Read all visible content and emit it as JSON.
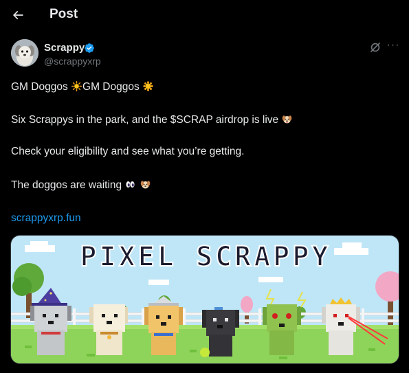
{
  "header": {
    "title": "Post"
  },
  "author": {
    "name": "Scrappy",
    "handle": "@scrappyxrp"
  },
  "post": {
    "line1_a": "GM Doggos",
    "line1_b": "GM Doggos",
    "line2": "Six Scrappys in the park, and the $SCRAP airdrop is live",
    "line3": "Check your eligibility and see what you’re getting.",
    "line4": "The doggos are waiting",
    "link": "scrappyxrp.fun"
  },
  "media": {
    "banner_text": "PIXEL SCRAPPY"
  },
  "icons": [
    "back-arrow-icon",
    "verified-icon",
    "grok-icon",
    "more-icon",
    "sun-icon",
    "dog-face-icon",
    "eyes-icon"
  ],
  "colors": {
    "background": "#000000",
    "text": "#e7e9ea",
    "muted": "#71767b",
    "link": "#1d9bf0",
    "verified": "#1d9bf0"
  }
}
